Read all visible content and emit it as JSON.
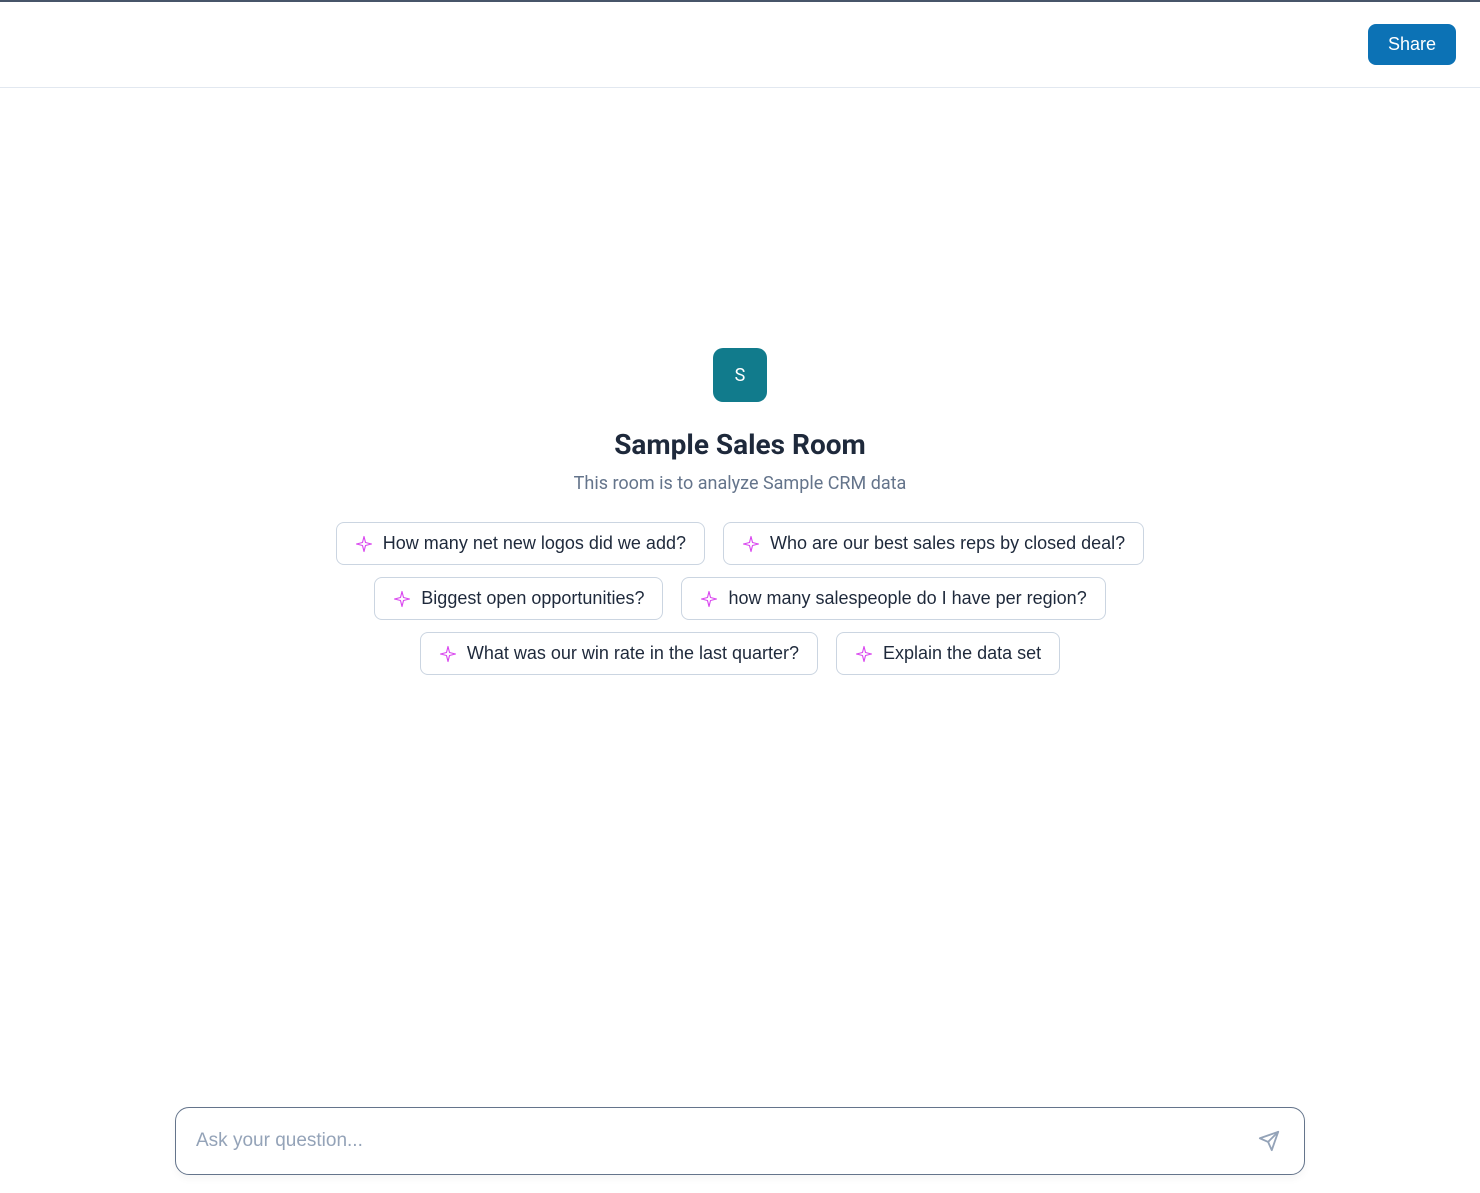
{
  "header": {
    "share_label": "Share"
  },
  "room": {
    "avatar_letter": "S",
    "title": "Sample Sales Room",
    "description": "This room is to analyze Sample CRM data"
  },
  "suggestions": [
    "How many net new logos did we add?",
    "Who are our best sales reps by closed deal?",
    "Biggest open opportunities?",
    "how many salespeople do I have per region?",
    "What was our win rate in the last quarter?",
    "Explain the data set"
  ],
  "chat": {
    "placeholder": "Ask your question...",
    "value": ""
  },
  "colors": {
    "primary": "#0c72b5",
    "avatar_bg": "#117b8c"
  }
}
